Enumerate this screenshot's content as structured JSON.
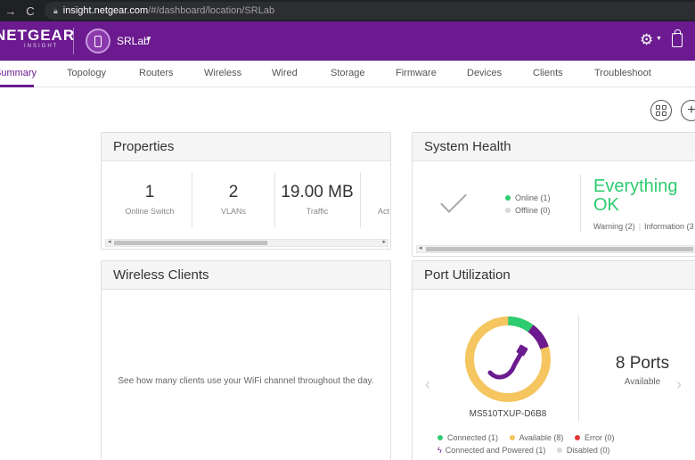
{
  "browser": {
    "url_host": "insight.netgear.com",
    "url_path": "/#/dashboard/location/SRLab"
  },
  "header": {
    "brand": "NETGEAR",
    "brand_sub": "INSIGHT",
    "location": "SRLab"
  },
  "tabs": [
    {
      "label": "Summary",
      "active": true
    },
    {
      "label": "Topology"
    },
    {
      "label": "Routers"
    },
    {
      "label": "Wireless"
    },
    {
      "label": "Wired"
    },
    {
      "label": "Storage"
    },
    {
      "label": "Firmware"
    },
    {
      "label": "Devices"
    },
    {
      "label": "Clients"
    },
    {
      "label": "Troubleshoot"
    }
  ],
  "properties": {
    "title": "Properties",
    "stats": [
      {
        "value": "1",
        "label": "Online Switch"
      },
      {
        "value": "2",
        "label": "VLANs"
      },
      {
        "value": "19.00 MB",
        "label": "Traffic"
      },
      {
        "value": "",
        "label": "Act"
      }
    ]
  },
  "system_health": {
    "title": "System Health",
    "online": "Online (1)",
    "offline": "Offline (0)",
    "status_line1": "Everything",
    "status_line2": "OK",
    "warning": "Warning (2)",
    "information": "Information (3"
  },
  "wireless_clients": {
    "title": "Wireless Clients",
    "message": "See how many clients use your WiFi channel throughout the day."
  },
  "port_utilization": {
    "title": "Port Utilization",
    "device": "MS510TXUP-D6B8",
    "ports_count": "8 Ports",
    "ports_label": "Available",
    "legend": {
      "connected": "Connected (1)",
      "available": "Available (8)",
      "error": "Error (0)",
      "connected_powered": "Connected and Powered (1)",
      "disabled": "Disabled (0)"
    },
    "donut": {
      "connected": 1,
      "powered": 1,
      "available": 8
    }
  },
  "colors": {
    "brand_purple": "#6b1a8f",
    "connected": "#2ecc71",
    "available": "#f5c55f",
    "error": "#e53935",
    "disabled": "#d8d8d8",
    "ok_green": "#2ecc71"
  }
}
